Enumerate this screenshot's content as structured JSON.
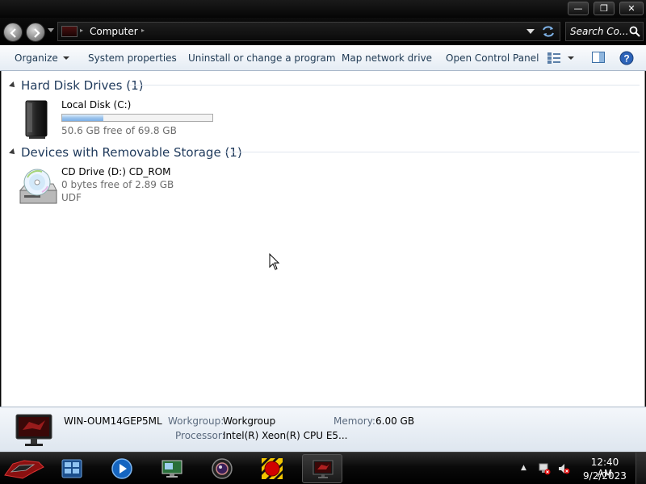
{
  "window": {
    "min_glyph": "—",
    "max_glyph": "❐",
    "close_glyph": "✕"
  },
  "address": {
    "location": "Computer",
    "search_placeholder": "Search Co..."
  },
  "toolbar": {
    "organize": "Organize",
    "system_properties": "System properties",
    "uninstall": "Uninstall or change a program",
    "map_drive": "Map network drive",
    "control_panel": "Open Control Panel"
  },
  "groups": {
    "hdd": {
      "title": "Hard Disk Drives (1)",
      "items": [
        {
          "name": "Local Disk (C:)",
          "free": "50.6 GB free of 69.8 GB",
          "used_fraction": 0.275
        }
      ]
    },
    "removable": {
      "title": "Devices with Removable Storage (1)",
      "items": [
        {
          "name": "CD Drive (D:) CD_ROM",
          "free": "0 bytes free of 2.89 GB",
          "fs": "UDF"
        }
      ]
    }
  },
  "details": {
    "computer_name": "WIN-OUM14GEP5ML",
    "workgroup_label": "Workgroup:",
    "workgroup_value": "Workgroup",
    "memory_label": "Memory:",
    "memory_value": "6.00 GB",
    "processor_label": "Processor:",
    "processor_value": "Intel(R) Xeon(R) CPU E5..."
  },
  "taskbar": {
    "time": "12:40 AM",
    "date": "9/2/2023"
  },
  "colors": {
    "accent": "#1e395b",
    "bar_fill": "#7cb0e6"
  }
}
